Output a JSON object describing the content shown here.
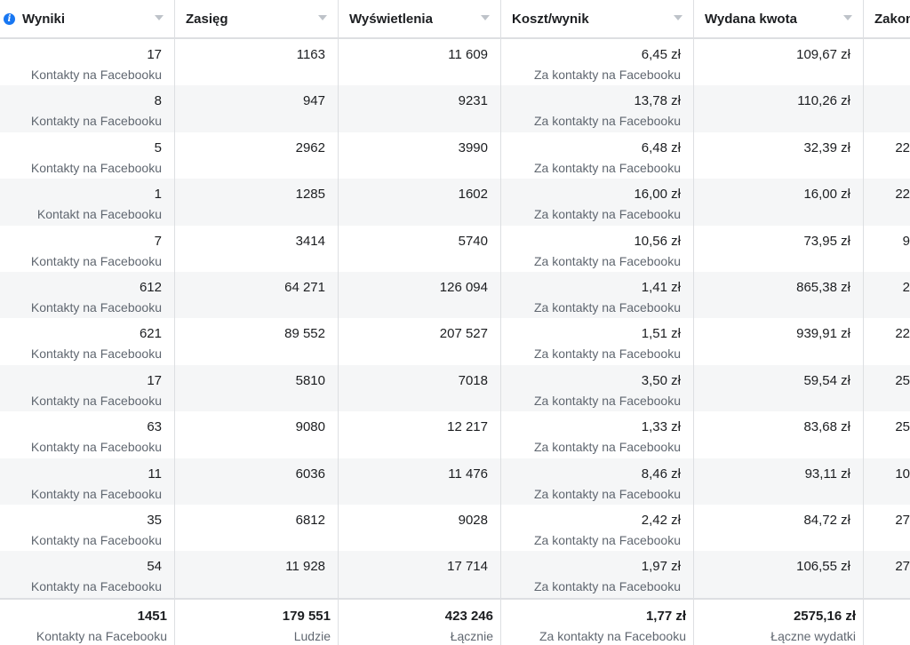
{
  "columns": [
    {
      "label": "Wyniki",
      "info_icon": true
    },
    {
      "label": "Zasięg"
    },
    {
      "label": "Wyświetlenia"
    },
    {
      "label": "Koszt/wynik"
    },
    {
      "label": "Wydana kwota"
    },
    {
      "label": "Zakon"
    }
  ],
  "rows": [
    {
      "results": "17",
      "results_sub": "Kontakty na Facebooku",
      "reach": "1163",
      "impressions": "11 609",
      "cost": "6,45 zł",
      "cost_sub": "Za kontakty na Facebooku",
      "spent": "109,67 zł",
      "partial": ""
    },
    {
      "results": "8",
      "results_sub": "Kontakty na Facebooku",
      "reach": "947",
      "impressions": "9231",
      "cost": "13,78 zł",
      "cost_sub": "Za kontakty na Facebooku",
      "spent": "110,26 zł",
      "partial": ""
    },
    {
      "results": "5",
      "results_sub": "Kontakty na Facebooku",
      "reach": "2962",
      "impressions": "3990",
      "cost": "6,48 zł",
      "cost_sub": "Za kontakty na Facebooku",
      "spent": "32,39 zł",
      "partial": "22"
    },
    {
      "results": "1",
      "results_sub": "Kontakt na Facebooku",
      "reach": "1285",
      "impressions": "1602",
      "cost": "16,00 zł",
      "cost_sub": "Za kontakty na Facebooku",
      "spent": "16,00 zł",
      "partial": "22"
    },
    {
      "results": "7",
      "results_sub": "Kontakty na Facebooku",
      "reach": "3414",
      "impressions": "5740",
      "cost": "10,56 zł",
      "cost_sub": "Za kontakty na Facebooku",
      "spent": "73,95 zł",
      "partial": "9"
    },
    {
      "results": "612",
      "results_sub": "Kontakty na Facebooku",
      "reach": "64 271",
      "impressions": "126 094",
      "cost": "1,41 zł",
      "cost_sub": "Za kontakty na Facebooku",
      "spent": "865,38 zł",
      "partial": "2"
    },
    {
      "results": "621",
      "results_sub": "Kontakty na Facebooku",
      "reach": "89 552",
      "impressions": "207 527",
      "cost": "1,51 zł",
      "cost_sub": "Za kontakty na Facebooku",
      "spent": "939,91 zł",
      "partial": "22"
    },
    {
      "results": "17",
      "results_sub": "Kontakty na Facebooku",
      "reach": "5810",
      "impressions": "7018",
      "cost": "3,50 zł",
      "cost_sub": "Za kontakty na Facebooku",
      "spent": "59,54 zł",
      "partial": "25"
    },
    {
      "results": "63",
      "results_sub": "Kontakty na Facebooku",
      "reach": "9080",
      "impressions": "12 217",
      "cost": "1,33 zł",
      "cost_sub": "Za kontakty na Facebooku",
      "spent": "83,68 zł",
      "partial": "25"
    },
    {
      "results": "11",
      "results_sub": "Kontakty na Facebooku",
      "reach": "6036",
      "impressions": "11 476",
      "cost": "8,46 zł",
      "cost_sub": "Za kontakty na Facebooku",
      "spent": "93,11 zł",
      "partial": "10"
    },
    {
      "results": "35",
      "results_sub": "Kontakty na Facebooku",
      "reach": "6812",
      "impressions": "9028",
      "cost": "2,42 zł",
      "cost_sub": "Za kontakty na Facebooku",
      "spent": "84,72 zł",
      "partial": "27"
    },
    {
      "results": "54",
      "results_sub": "Kontakty na Facebooku",
      "reach": "11 928",
      "impressions": "17 714",
      "cost": "1,97 zł",
      "cost_sub": "Za kontakty na Facebooku",
      "spent": "106,55 zł",
      "partial": "27"
    }
  ],
  "totals": {
    "results": "1451",
    "results_sub": "Kontakty na Facebooku",
    "reach": "179 551",
    "reach_sub": "Ludzie",
    "impressions": "423 246",
    "impressions_sub": "Łącznie",
    "cost": "1,77 zł",
    "cost_sub": "Za kontakty na Facebooku",
    "spent": "2575,16 zł",
    "spent_sub": "Łączne wydatki"
  }
}
